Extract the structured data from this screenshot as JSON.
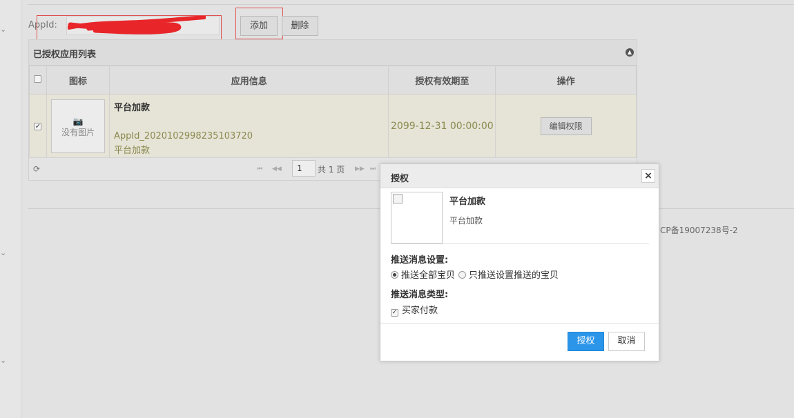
{
  "form": {
    "appid_label": "AppId:",
    "appid_value": "",
    "add_label": "添加",
    "delete_label": "删除"
  },
  "panel": {
    "title": "已授权应用列表",
    "columns": [
      "图标",
      "应用信息",
      "授权有效期至",
      "操作"
    ],
    "rows": [
      {
        "checked": true,
        "no_image_label": "没有图片",
        "app_name": "平台加款",
        "app_id": "AppId_2020102998235103720",
        "app_desc": "平台加款",
        "expire": "2099-12-31 00:00:00",
        "action_label": "编辑权限"
      }
    ],
    "pager": {
      "page": "1",
      "total_label": "共 1 页"
    }
  },
  "footer": {
    "icp_text": "CP备19007238号-2"
  },
  "dialog": {
    "title": "授权",
    "close_glyph": "×",
    "app_name": "平台加款",
    "app_sub": "平台加款",
    "push_setting_label": "推送消息设置:",
    "option_all": "推送全部宝贝",
    "option_selected": "只推送设置推送的宝贝",
    "push_type_label": "推送消息类型:",
    "type_buyer_pay": "买家付款",
    "ok_label": "授权",
    "cancel_label": "取消"
  },
  "colors": {
    "primary_button": "#2b95e9",
    "row_highlight": "#e6e3d7",
    "olive_text": "#8a8a4e",
    "annotation_red": "#e05050"
  }
}
